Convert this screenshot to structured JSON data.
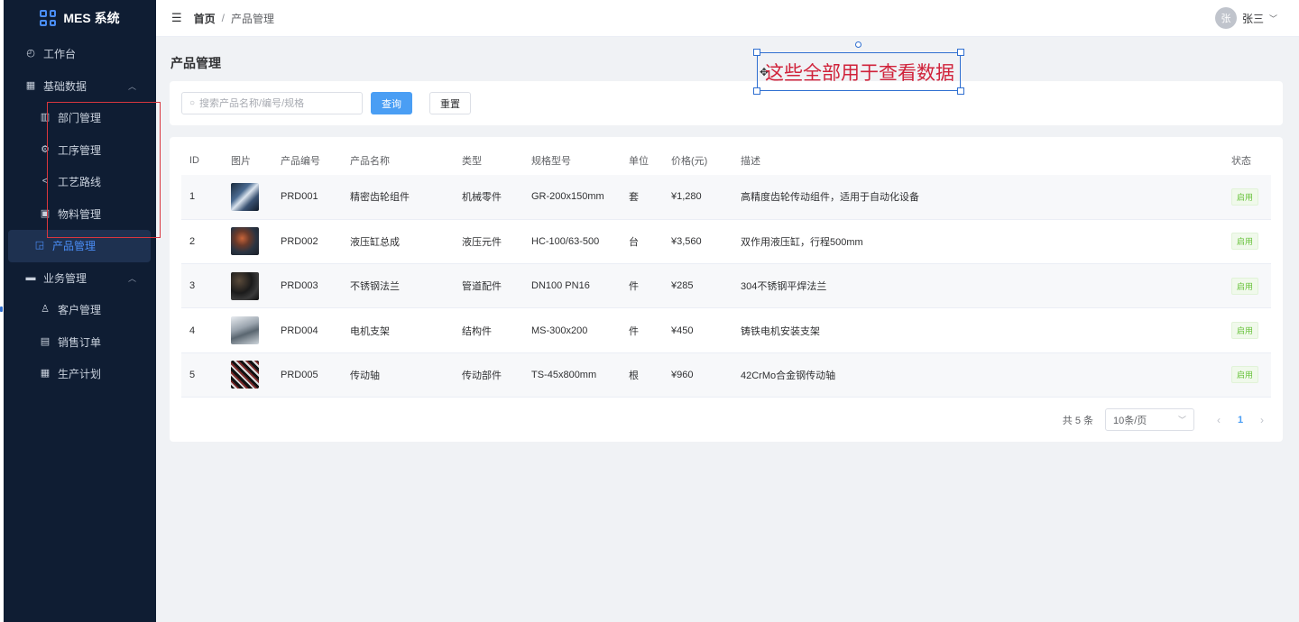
{
  "app": {
    "title": "MES 系统",
    "accent": "#4a8df6",
    "sidebar_bg": "#0f1d33"
  },
  "sidebar": {
    "items": [
      {
        "label": "工作台",
        "icon": "dashboard-icon"
      },
      {
        "label": "基础数据",
        "icon": "grid-icon",
        "expanded": true
      },
      {
        "label": "部门管理",
        "icon": "building-icon"
      },
      {
        "label": "工序管理",
        "icon": "gear-icon"
      },
      {
        "label": "工艺路线",
        "icon": "share-icon"
      },
      {
        "label": "物料管理",
        "icon": "box-icon"
      },
      {
        "label": "产品管理",
        "icon": "bag-icon",
        "active": true
      },
      {
        "label": "业务管理",
        "icon": "briefcase-icon",
        "expanded": true
      },
      {
        "label": "客户管理",
        "icon": "user-icon"
      },
      {
        "label": "销售订单",
        "icon": "document-icon"
      },
      {
        "label": "生产计划",
        "icon": "calendar-icon"
      }
    ]
  },
  "header": {
    "breadcrumb_home": "首页",
    "breadcrumb_sep": "/",
    "breadcrumb_current": "产品管理",
    "user_avatar": "张",
    "user_name": "张三"
  },
  "page": {
    "title": "产品管理"
  },
  "search": {
    "placeholder": "搜索产品名称/编号/规格",
    "value": "",
    "query_label": "查询",
    "reset_label": "重置"
  },
  "table": {
    "columns": [
      "ID",
      "图片",
      "产品编号",
      "产品名称",
      "类型",
      "规格型号",
      "单位",
      "价格(元)",
      "描述",
      "状态"
    ],
    "rows": [
      {
        "id": "1",
        "code": "PRD001",
        "name": "精密齿轮组件",
        "type": "机械零件",
        "spec": "GR-200x150mm",
        "unit": "套",
        "price": "¥1,280",
        "desc": "高精度齿轮传动组件，适用于自动化设备",
        "status": "启用"
      },
      {
        "id": "2",
        "code": "PRD002",
        "name": "液压缸总成",
        "type": "液压元件",
        "spec": "HC-100/63-500",
        "unit": "台",
        "price": "¥3,560",
        "desc": "双作用液压缸，行程500mm",
        "status": "启用"
      },
      {
        "id": "3",
        "code": "PRD003",
        "name": "不锈钢法兰",
        "type": "管道配件",
        "spec": "DN100 PN16",
        "unit": "件",
        "price": "¥285",
        "desc": "304不锈钢平焊法兰",
        "status": "启用"
      },
      {
        "id": "4",
        "code": "PRD004",
        "name": "电机支架",
        "type": "结构件",
        "spec": "MS-300x200",
        "unit": "件",
        "price": "¥450",
        "desc": "铸铁电机安装支架",
        "status": "启用"
      },
      {
        "id": "5",
        "code": "PRD005",
        "name": "传动轴",
        "type": "传动部件",
        "spec": "TS-45x800mm",
        "unit": "根",
        "price": "¥960",
        "desc": "42CrMo合金钢传动轴",
        "status": "启用"
      }
    ]
  },
  "pagination": {
    "total": "共 5 条",
    "page_size": "10条/页",
    "current_page": "1",
    "prev": "‹",
    "next": "›"
  },
  "annotation": {
    "text": "这些全部用于查看数据",
    "color": "#d0223a"
  }
}
